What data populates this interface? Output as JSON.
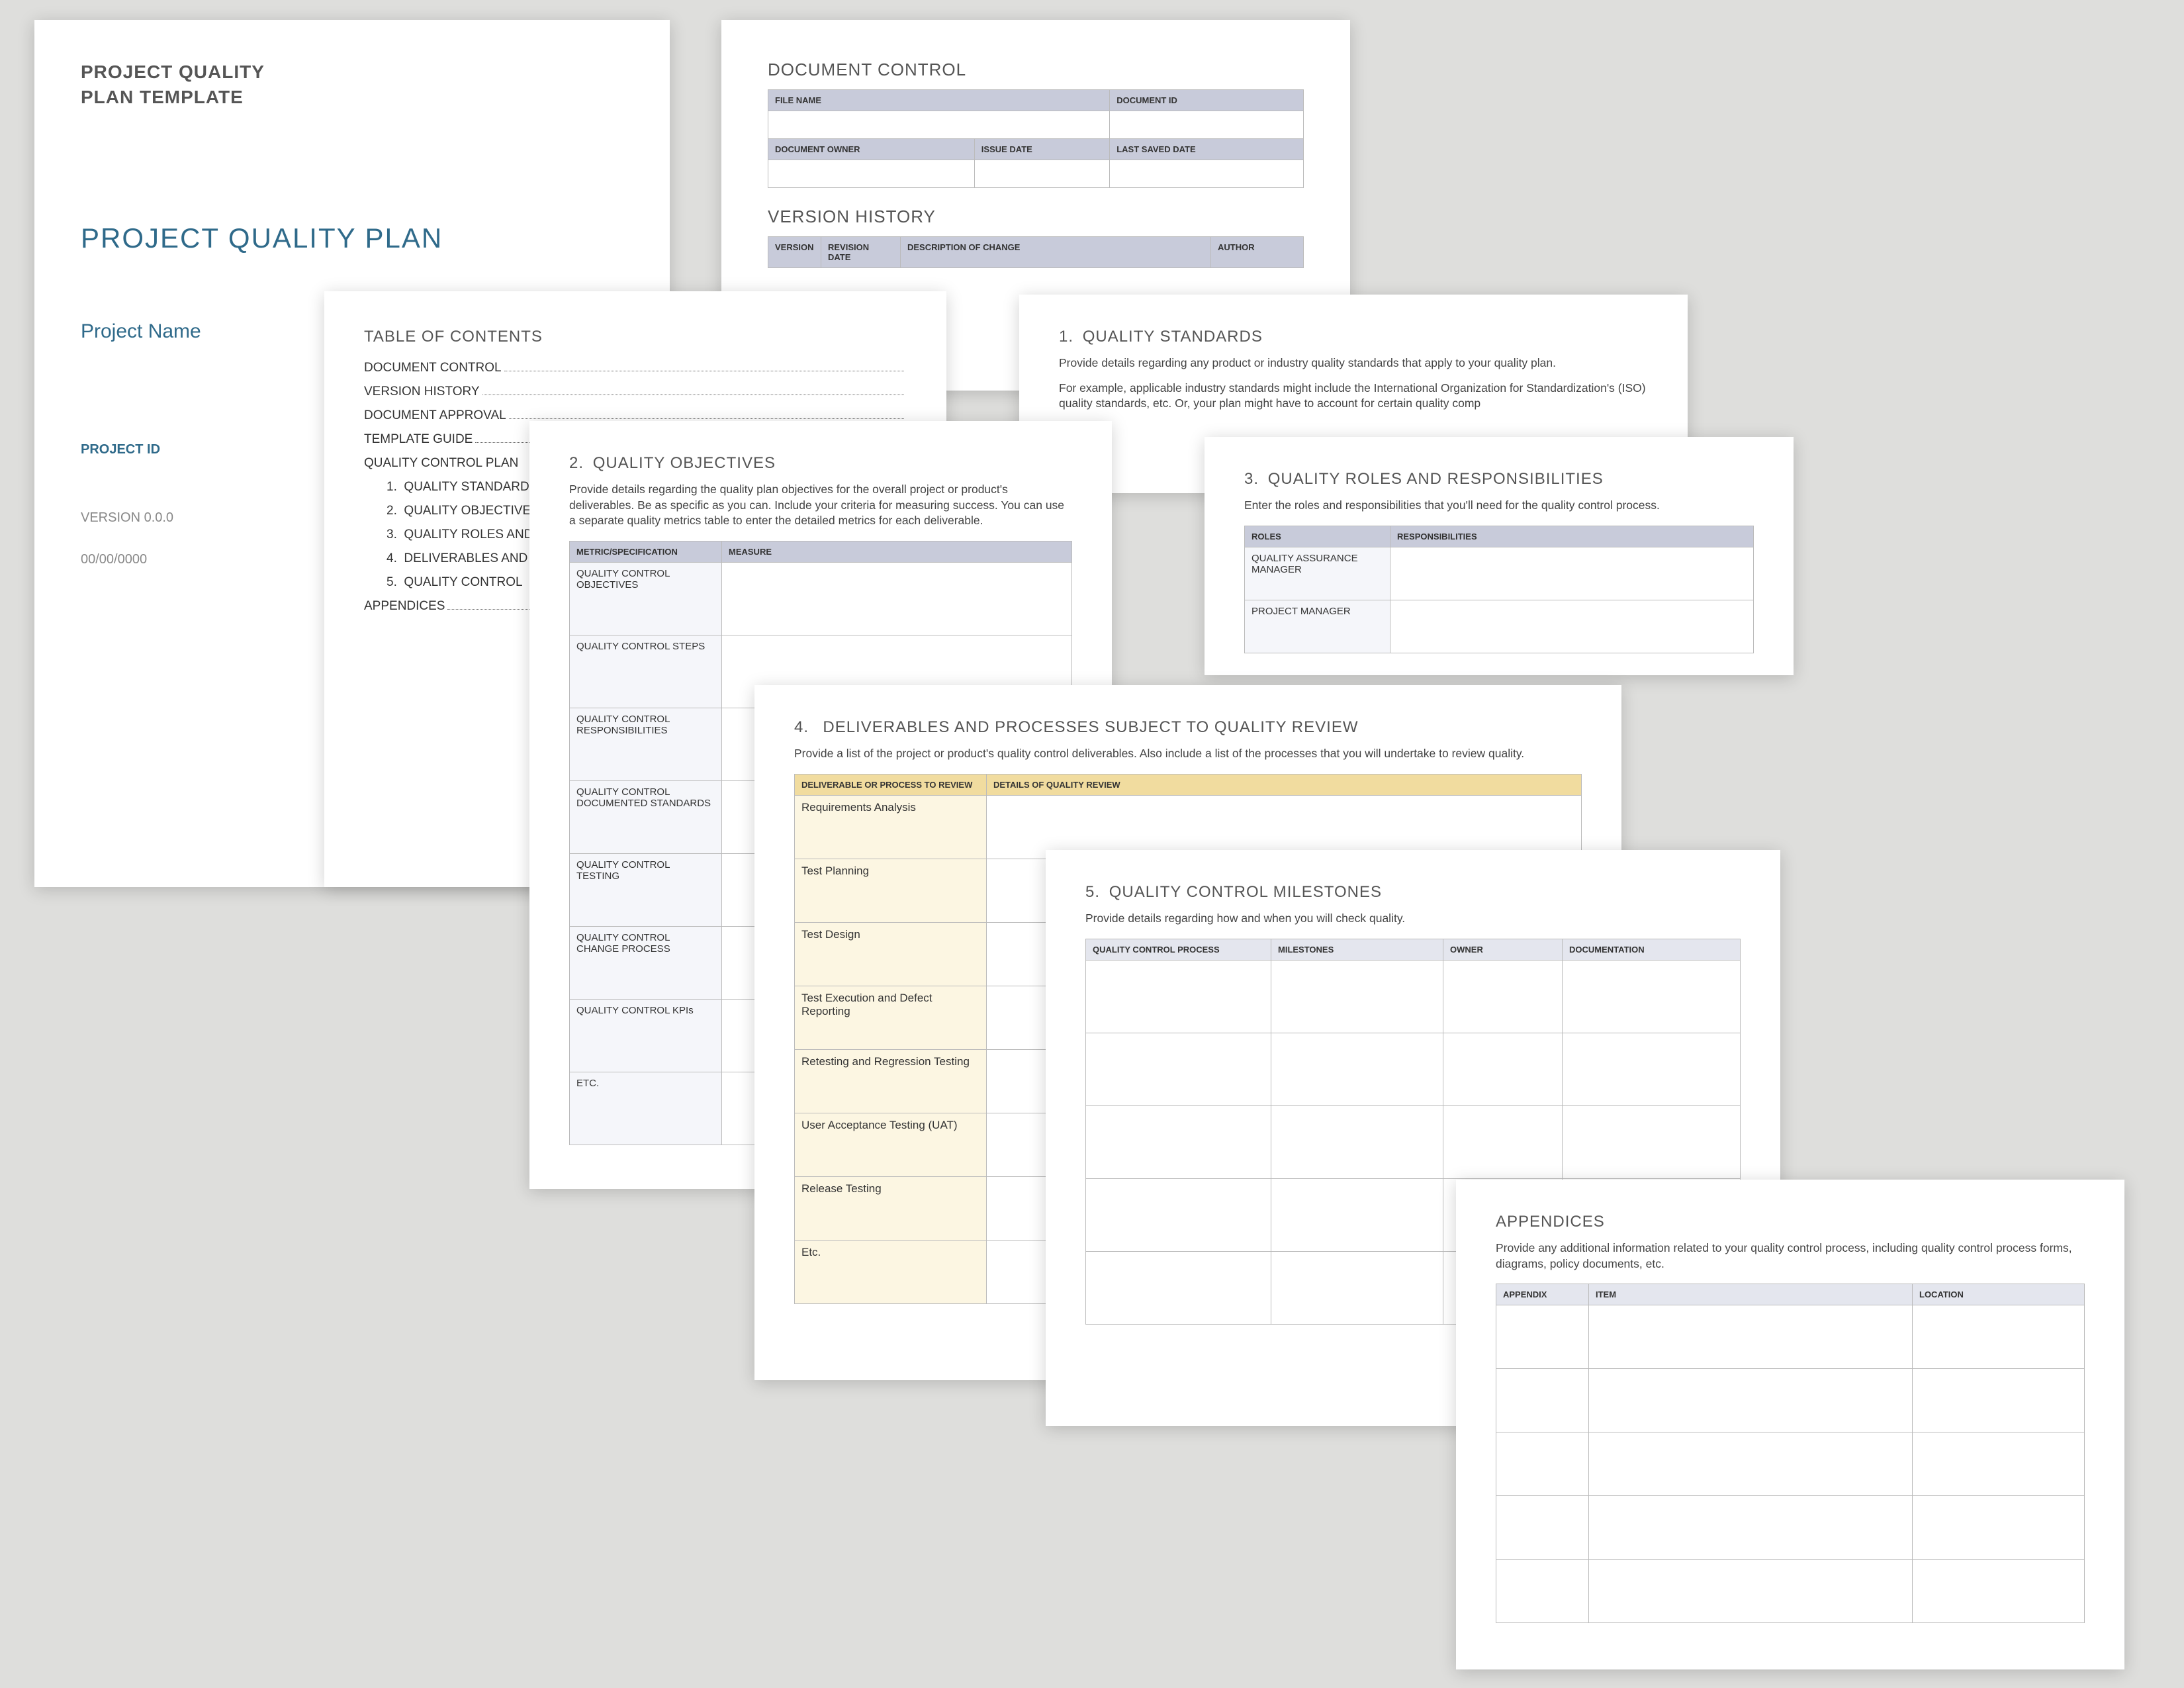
{
  "cover": {
    "template_title_l1": "PROJECT QUALITY",
    "template_title_l2": "PLAN TEMPLATE",
    "doc_title": "PROJECT QUALITY PLAN",
    "project_name": "Project Name",
    "project_id_label": "PROJECT ID",
    "version": "VERSION 0.0.0",
    "date": "00/00/0000"
  },
  "doc_control": {
    "heading": "DOCUMENT CONTROL",
    "h_file_name": "FILE NAME",
    "h_doc_id": "DOCUMENT ID",
    "h_owner": "DOCUMENT OWNER",
    "h_issue": "ISSUE DATE",
    "h_saved": "LAST SAVED DATE"
  },
  "version_history": {
    "heading": "VERSION HISTORY",
    "h_ver": "VERSION",
    "h_rev": "REVISION DATE",
    "h_desc": "DESCRIPTION OF CHANGE",
    "h_auth": "AUTHOR"
  },
  "toc": {
    "heading": "TABLE OF CONTENTS",
    "items": [
      {
        "label": "DOCUMENT CONTROL"
      },
      {
        "label": "VERSION HISTORY"
      },
      {
        "label": "DOCUMENT APPROVAL"
      },
      {
        "label": "TEMPLATE GUIDE"
      },
      {
        "label": "QUALITY CONTROL PLAN"
      }
    ],
    "numbered": [
      {
        "num": "1.",
        "label": "QUALITY STANDARD"
      },
      {
        "num": "2.",
        "label": "QUALITY OBJECTIVE"
      },
      {
        "num": "3.",
        "label": "QUALITY ROLES AND"
      },
      {
        "num": "4.",
        "label": "DELIVERABLES AND"
      },
      {
        "num": "5.",
        "label": "QUALITY CONTROL"
      }
    ],
    "appendices": "APPENDICES"
  },
  "standards": {
    "num": "1.",
    "title": "QUALITY STANDARDS",
    "p1": "Provide details regarding any product or industry quality standards that apply to your quality plan.",
    "p2": "For example, applicable industry standards might include the International Organization for Standardization's (ISO) quality standards, etc. Or, your plan might have to account for certain quality comp"
  },
  "objectives": {
    "num": "2.",
    "title": "QUALITY OBJECTIVES",
    "intro": "Provide details regarding the quality plan objectives for the overall project or product's deliverables. Be as specific as you can. Include your criteria for measuring success. You can use a separate quality metrics table to enter the detailed metrics for each deliverable.",
    "h_metric": "METRIC/SPECIFICATION",
    "h_measure": "MEASURE",
    "rows": [
      "QUALITY CONTROL OBJECTIVES",
      "QUALITY CONTROL STEPS",
      "QUALITY CONTROL RESPONSIBILITIES",
      "QUALITY CONTROL DOCUMENTED STANDARDS",
      "QUALITY CONTROL TESTING",
      "QUALITY CONTROL CHANGE PROCESS",
      "QUALITY CONTROL KPIs",
      "ETC."
    ]
  },
  "roles": {
    "num": "3.",
    "title": "QUALITY ROLES AND RESPONSIBILITIES",
    "intro": "Enter the roles and responsibilities that you'll need for the quality control process.",
    "h_roles": "ROLES",
    "h_resp": "RESPONSIBILITIES",
    "rows": [
      "QUALITY ASSURANCE MANAGER",
      "PROJECT MANAGER"
    ]
  },
  "deliverables": {
    "num": "4.",
    "title": "DELIVERABLES AND PROCESSES SUBJECT TO QUALITY REVIEW",
    "intro": "Provide a list of the project or product's quality control deliverables. Also include a list of the processes that you will undertake to review quality.",
    "h_proc": "DELIVERABLE OR PROCESS TO REVIEW",
    "h_detail": "DETAILS OF QUALITY REVIEW",
    "rows": [
      "Requirements Analysis",
      "Test Planning",
      "Test Design",
      "Test Execution and Defect Reporting",
      "Retesting and Regression Testing",
      "User Acceptance Testing (UAT)",
      "Release Testing",
      "Etc."
    ]
  },
  "milestones": {
    "num": "5.",
    "title": "QUALITY CONTROL MILESTONES",
    "intro": "Provide details regarding how and when you will check quality.",
    "h_proc": "QUALITY CONTROL PROCESS",
    "h_mile": "MILESTONES",
    "h_owner": "OWNER",
    "h_doc": "DOCUMENTATION",
    "row_count": 5
  },
  "appendices": {
    "title": "APPENDICES",
    "intro": "Provide any additional information related to your quality control process, including quality control process forms, diagrams, policy documents, etc.",
    "h_apx": "APPENDIX",
    "h_item": "ITEM",
    "h_loc": "LOCATION",
    "row_count": 5
  }
}
